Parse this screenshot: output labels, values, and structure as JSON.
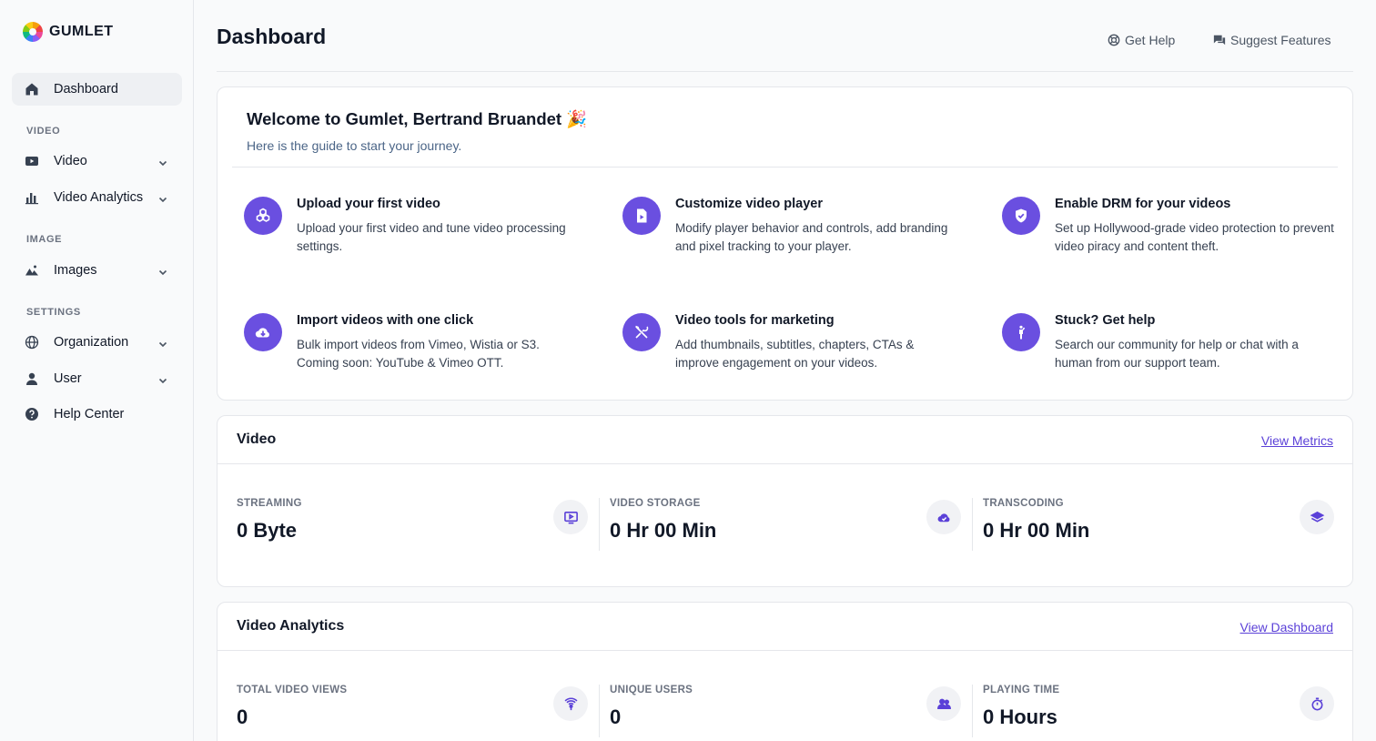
{
  "brand": {
    "name": "GUMLET"
  },
  "sidebar": {
    "dashboard": "Dashboard",
    "sections": {
      "video": "VIDEO",
      "image": "IMAGE",
      "settings": "SETTINGS"
    },
    "items": {
      "video": "Video",
      "video_analytics": "Video Analytics",
      "images": "Images",
      "organization": "Organization",
      "user": "User",
      "help_center": "Help Center"
    }
  },
  "header": {
    "title": "Dashboard",
    "get_help": "Get Help",
    "suggest_features": "Suggest Features"
  },
  "welcome": {
    "title": "Welcome to Gumlet, Bertrand Bruandet 🎉",
    "subtitle": "Here is the guide to start your journey.",
    "guides": [
      {
        "title": "Upload your first video",
        "desc": "Upload your first video and tune video processing settings.",
        "icon": "cubes-icon"
      },
      {
        "title": "Customize video player",
        "desc": "Modify player behavior and controls, add branding and pixel tracking to your player.",
        "icon": "file-play-icon"
      },
      {
        "title": "Enable DRM for your videos",
        "desc": "Set up Hollywood-grade video protection to prevent video piracy and content theft.",
        "icon": "shield-check-icon"
      },
      {
        "title": "Import videos with one click",
        "desc": "Bulk import videos from Vimeo, Wistia or S3. Coming soon: YouTube & Vimeo OTT.",
        "icon": "cloud-download-icon"
      },
      {
        "title": "Video tools for marketing",
        "desc": "Add thumbnails, subtitles, chapters, CTAs & improve engagement on your videos.",
        "icon": "tools-icon"
      },
      {
        "title": "Stuck? Get help",
        "desc": "Search our community for help or chat with a human from our support team.",
        "icon": "person-icon"
      }
    ]
  },
  "video_card": {
    "title": "Video",
    "link": "View Metrics",
    "metrics": [
      {
        "label": "STREAMING",
        "value": "0 Byte",
        "icon": "play-screen-icon"
      },
      {
        "label": "VIDEO STORAGE",
        "value": "0 Hr 00 Min",
        "icon": "cloud-check-icon"
      },
      {
        "label": "TRANSCODING",
        "value": "0 Hr 00 Min",
        "icon": "layers-icon"
      }
    ]
  },
  "analytics_card": {
    "title": "Video Analytics",
    "link": "View Dashboard",
    "metrics": [
      {
        "label": "TOTAL VIDEO VIEWS",
        "value": "0",
        "icon": "broadcast-icon"
      },
      {
        "label": "UNIQUE USERS",
        "value": "0",
        "icon": "users-icon"
      },
      {
        "label": "PLAYING TIME",
        "value": "0 Hours",
        "icon": "stopwatch-icon"
      }
    ]
  },
  "colors": {
    "accent": "#6a4fe0",
    "link": "#5b41d8",
    "background": "#f9fafb"
  }
}
